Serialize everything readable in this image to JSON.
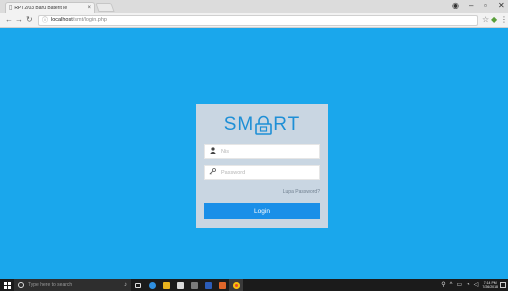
{
  "browser": {
    "tab_title": "RPT2/03 Baru Baterit le",
    "tab_favicon": "page-icon",
    "window_minimize": "–",
    "window_maximize": "▫",
    "window_close": "✕",
    "url_host": "localhost",
    "url_path": "/smt/login.php"
  },
  "login": {
    "logo_left": "SM",
    "logo_right": "RT",
    "logo_icon": "padlock-icon",
    "username_placeholder": "Nis",
    "password_placeholder": "Password",
    "forgot_label": "Lupa Password?",
    "login_label": "Login",
    "accent_color": "#1a8fe8",
    "background_color": "#1aa7ec"
  },
  "taskbar": {
    "search_placeholder": "Type here to search",
    "time": "7:14 PM",
    "date": "7/26/2018"
  }
}
